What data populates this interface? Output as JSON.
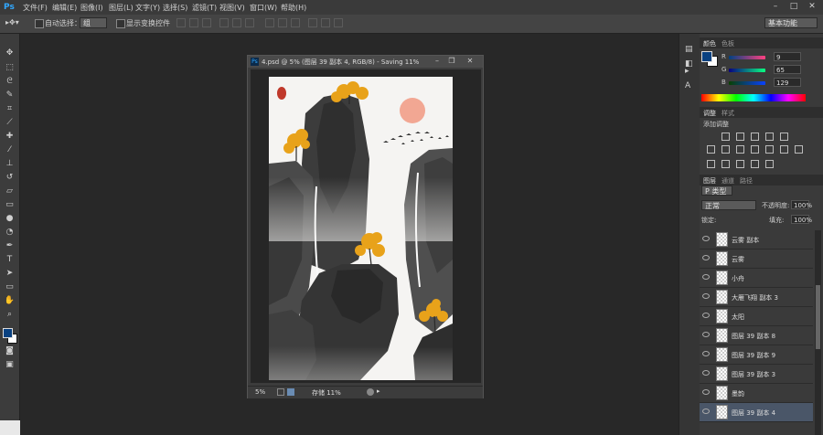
{
  "app": {
    "logo": "Ps"
  },
  "menu": [
    "文件(F)",
    "编辑(E)",
    "图像(I)",
    "图层(L)",
    "文字(Y)",
    "选择(S)",
    "滤镜(T)",
    "视图(V)",
    "窗口(W)",
    "帮助(H)"
  ],
  "window_controls": {
    "minimize": "–",
    "maximize": "□",
    "close": "✕"
  },
  "options": {
    "auto_select_label": "自动选择：",
    "auto_select_value": "组",
    "show_transform_label": "显示变换控件",
    "workspace": "基本功能"
  },
  "document": {
    "title": "4.psd @ 5% (图层 39 副本 4, RGB/8) - Saving 11%",
    "zoom": "5%",
    "status": "存储 11%",
    "title_buttons": {
      "minimize": "–",
      "restore": "❐",
      "close": "✕"
    }
  },
  "color_panel": {
    "tabs": [
      "颜色",
      "色板"
    ],
    "r_label": "R",
    "r_value": "9",
    "g_label": "G",
    "g_value": "65",
    "b_label": "B",
    "b_value": "129",
    "foreground": "#094181"
  },
  "adjust_panel": {
    "tabs": [
      "调整",
      "样式"
    ],
    "heading": "添加调整"
  },
  "layers_panel": {
    "tabs": [
      "图层",
      "通道",
      "路径"
    ],
    "filter": "P 类型",
    "blend_mode": "正常",
    "opacity_label": "不透明度:",
    "opacity_value": "100%",
    "lock_label": "锁定:",
    "fill_label": "填充:",
    "fill_value": "100%",
    "layers": [
      {
        "name": "云雾 副本"
      },
      {
        "name": "云雾"
      },
      {
        "name": "小舟"
      },
      {
        "name": "大雁飞翔 副本 3"
      },
      {
        "name": "太阳"
      },
      {
        "name": "图层 39 副本 8"
      },
      {
        "name": "图层 39 副本 9"
      },
      {
        "name": "图层 39 副本 3"
      },
      {
        "name": "墨韵"
      },
      {
        "name": "图层 39 副本 4",
        "selected": true
      }
    ]
  },
  "icons": {
    "move": "move-tool-icon",
    "marquee": "marquee-icon",
    "lasso": "lasso-icon",
    "wand": "quick-select-icon",
    "crop": "crop-icon",
    "eyedropper": "eyedropper-icon",
    "heal": "healing-icon",
    "brush": "brush-icon",
    "stamp": "clone-stamp-icon",
    "history": "history-brush-icon",
    "eraser": "eraser-icon",
    "gradient": "gradient-icon",
    "blur": "blur-icon",
    "dodge": "dodge-icon",
    "pen": "pen-icon",
    "type": "type-icon",
    "path": "path-select-icon",
    "shape": "rectangle-icon",
    "hand": "hand-icon",
    "zoom": "zoom-icon"
  }
}
